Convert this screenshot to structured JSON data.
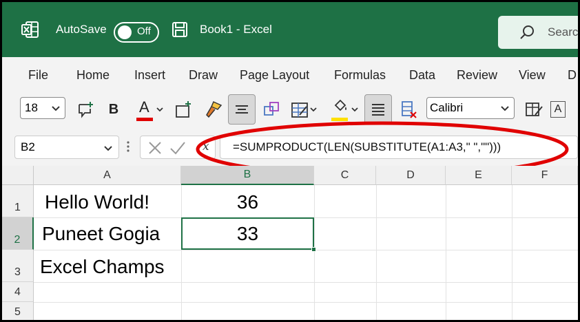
{
  "titlebar": {
    "autosave_label": "AutoSave",
    "autosave_state": "Off",
    "document_title": "Book1  -  Excel",
    "search_text": "Searc"
  },
  "menu": {
    "items": [
      "File",
      "Home",
      "Insert",
      "Draw",
      "Page Layout",
      "Formulas",
      "Data",
      "Review",
      "View",
      "D"
    ]
  },
  "toolbar": {
    "font_size": "18",
    "font_name": "Calibri",
    "bold_label": "B",
    "font_color_label": "A",
    "font_color": "#e00000",
    "highlight_color": "#ffe000",
    "style_label": "A"
  },
  "formula_bar": {
    "name_box": "B2",
    "fx_label": "x",
    "formula": "=SUMPRODUCT(LEN(SUBSTITUTE(A1:A3,\" \",\"\")))"
  },
  "sheet": {
    "columns": [
      "A",
      "B",
      "C",
      "D",
      "E",
      "F"
    ],
    "rows": [
      "1",
      "2",
      "3",
      "4",
      "5"
    ],
    "cells": {
      "A1": "Hello World!",
      "B1": "36",
      "A2": "Puneet Gogia",
      "B2": "33",
      "A3": "Excel Champs"
    },
    "selected_cell": "B2"
  },
  "colors": {
    "accent": "#1e7145",
    "annotation": "#e00000"
  }
}
